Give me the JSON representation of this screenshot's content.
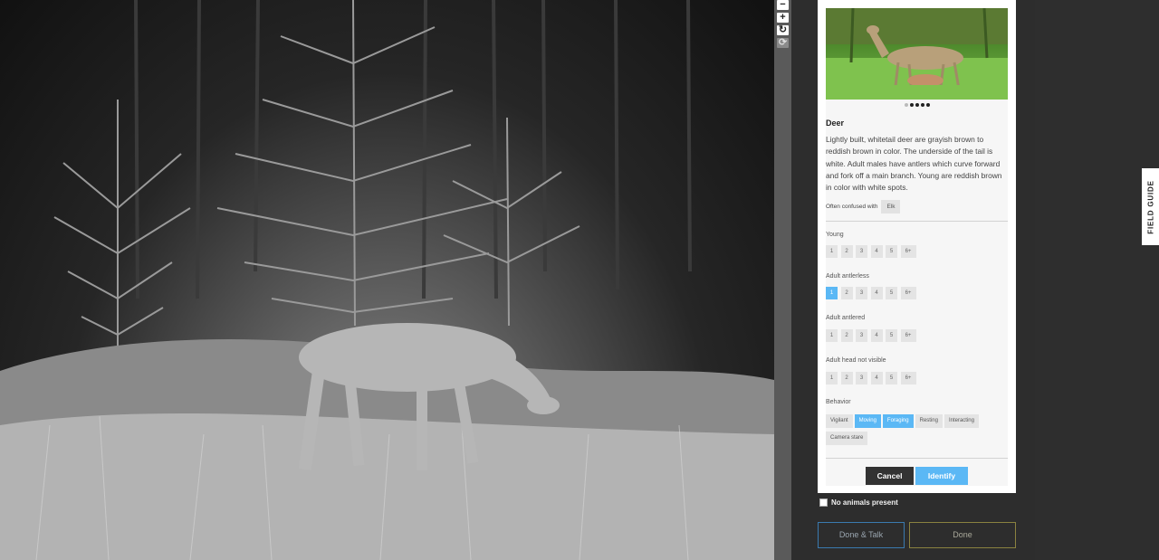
{
  "zoom": {
    "out_label": "−",
    "in_label": "+",
    "rotate_label": "↻",
    "reset_label": "⟳"
  },
  "guide": {
    "dots_total": 5,
    "animal_name": "Deer",
    "description": "Lightly built, whitetail deer are grayish brown to reddish brown in color. The underside of the tail is white. Adult males have antlers which curve forward and fork off a main branch. Young are reddish brown in color with white spots.",
    "confused_label": "Often confused with",
    "confused_with": "Elk"
  },
  "questions": [
    {
      "label": "Young",
      "options": [
        "1",
        "2",
        "3",
        "4",
        "5",
        "6+"
      ],
      "selected": null
    },
    {
      "label": "Adult antlerless",
      "options": [
        "1",
        "2",
        "3",
        "4",
        "5",
        "6+"
      ],
      "selected": "1"
    },
    {
      "label": "Adult antlered",
      "options": [
        "1",
        "2",
        "3",
        "4",
        "5",
        "6+"
      ],
      "selected": null
    },
    {
      "label": "Adult head not visible",
      "options": [
        "1",
        "2",
        "3",
        "4",
        "5",
        "6+"
      ],
      "selected": null
    }
  ],
  "behavior": {
    "label": "Behavior",
    "options": [
      {
        "label": "Vigilant",
        "selected": false
      },
      {
        "label": "Moving",
        "selected": true
      },
      {
        "label": "Foraging",
        "selected": true
      },
      {
        "label": "Resting",
        "selected": false
      },
      {
        "label": "Interacting",
        "selected": false
      },
      {
        "label": "Camera stare",
        "selected": false
      }
    ]
  },
  "actions": {
    "cancel_label": "Cancel",
    "identify_label": "Identify"
  },
  "no_animals_label": "No animals present",
  "done_talk_label": "Done & Talk",
  "done_label": "Done",
  "field_guide_label": "FIELD GUIDE",
  "colors": {
    "accent": "#5bb8f5",
    "panel_bg": "#f6f6f6",
    "page_bg": "#2e2e2e"
  }
}
